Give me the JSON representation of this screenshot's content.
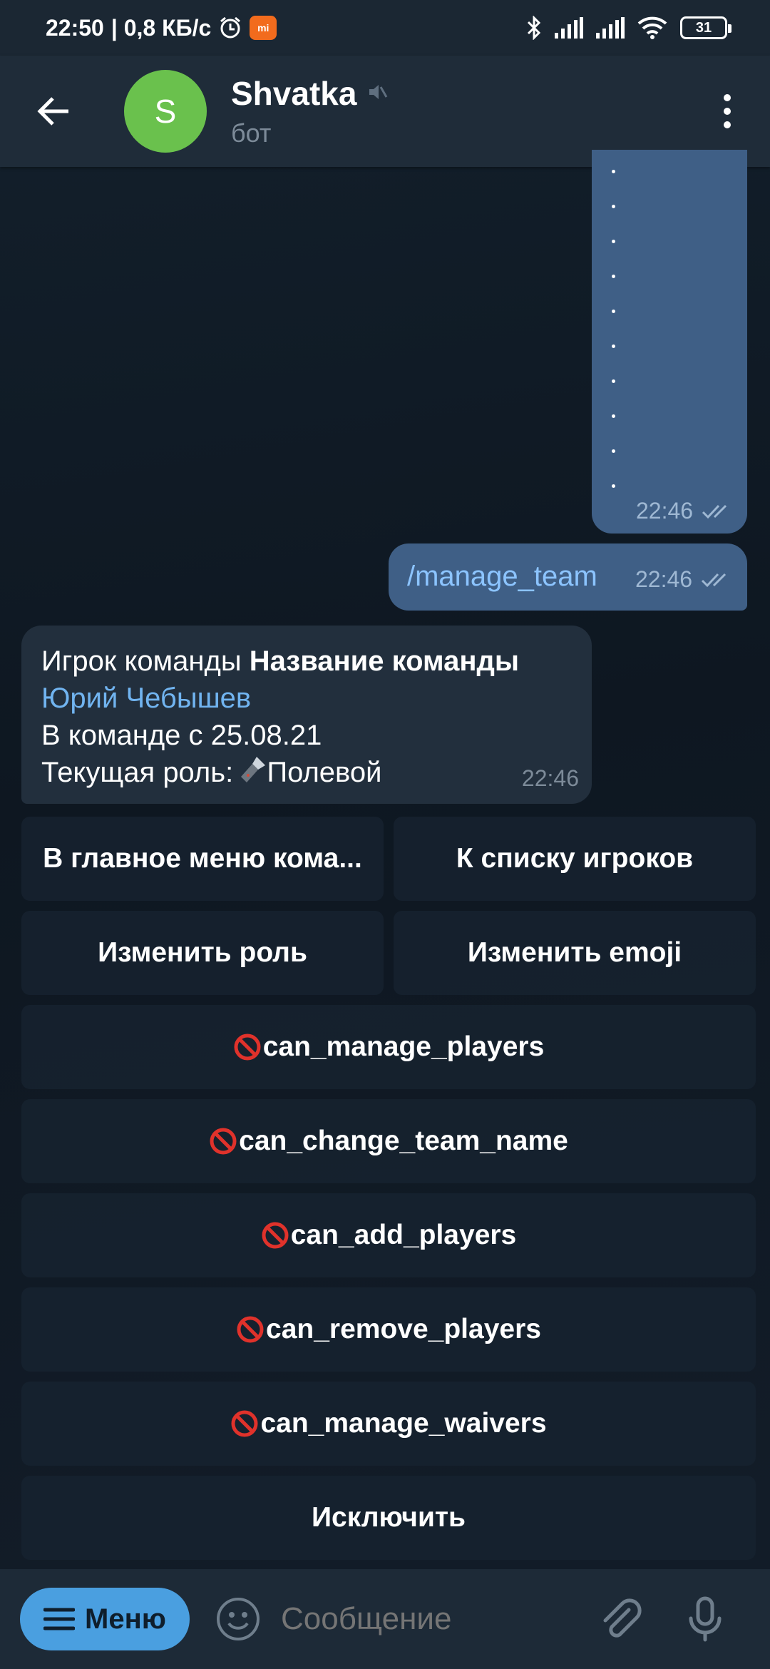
{
  "status_bar": {
    "time": "22:50",
    "speed": "| 0,8 КБ/с",
    "battery": "31",
    "icons": [
      "alarm-icon",
      "mi-app-icon",
      "bluetooth-icon",
      "signal-icon",
      "signal-icon",
      "wifi-icon",
      "battery-icon"
    ]
  },
  "header": {
    "avatar_letter": "S",
    "title": "Shvatka",
    "subtitle": "бот",
    "muted": true,
    "avatar_color": "#6ac14d"
  },
  "messages": {
    "outgoing_dots_time": "22:46",
    "command": "/manage_team",
    "command_time": "22:46",
    "incoming": {
      "line1_prefix": "Игрок команды ",
      "line1_bold": "Название команды",
      "player_link": "Юрий Чебышев",
      "joined": "В команде с 25.08.21",
      "role_prefix": "Текущая роль: ",
      "role": "Полевой",
      "time": "22:46"
    }
  },
  "keyboard": {
    "main_menu": "В главное меню кома...",
    "players_list": "К списку игроков",
    "change_role": "Изменить роль",
    "change_emoji": "Изменить emoji",
    "can_manage_players": "can_manage_players",
    "can_change_team_name": "can_change_team_name",
    "can_add_players": "can_add_players",
    "can_remove_players": "can_remove_players",
    "can_manage_waivers": "can_manage_waivers",
    "exclude": "Исключить"
  },
  "bottom": {
    "menu_label": "Меню",
    "input_placeholder": "Сообщение"
  },
  "colors": {
    "accent": "#4a9fe0",
    "outgoing_bubble": "#3f5f86",
    "incoming_bubble": "#222f3d",
    "link": "#71b4f0"
  }
}
